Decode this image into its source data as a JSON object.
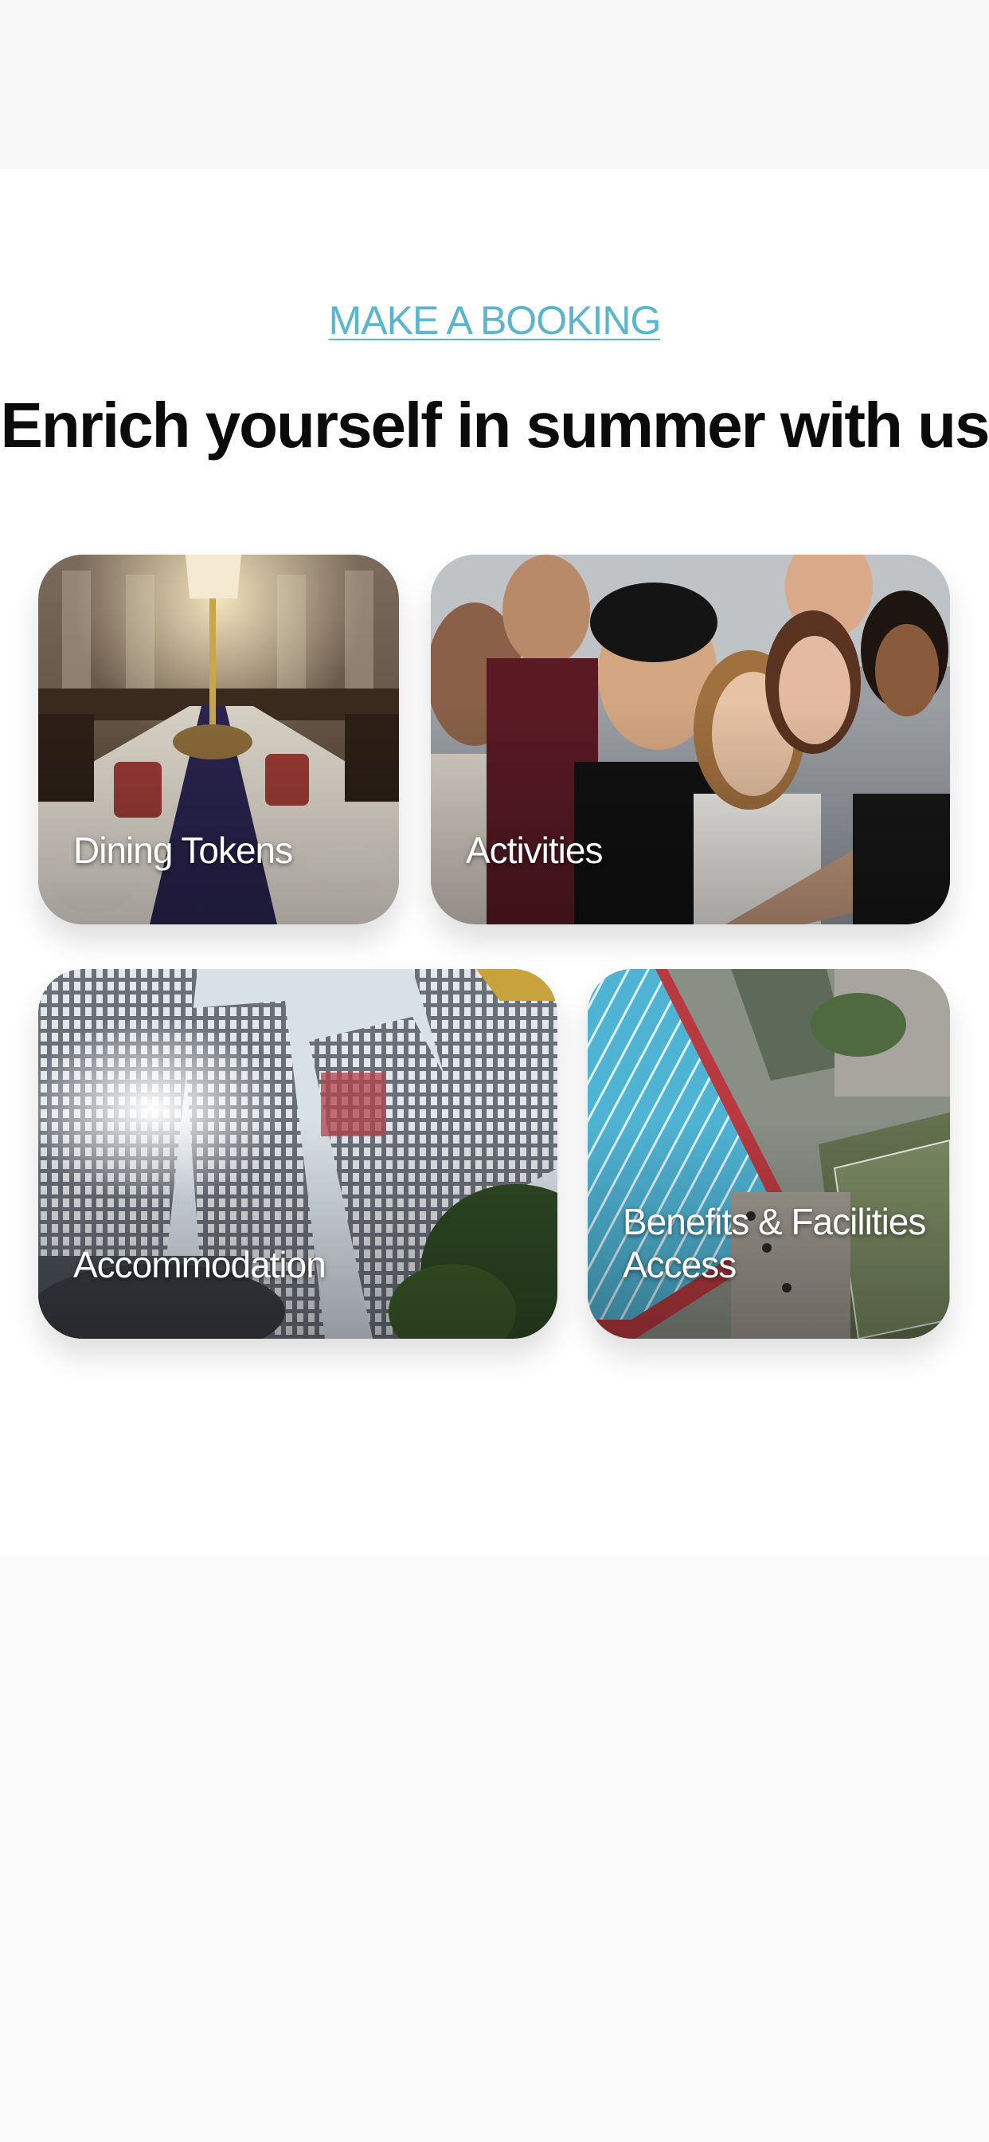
{
  "booking_link": {
    "label": "MAKE A BOOKING"
  },
  "headline": "Enrich yourself in summer with us",
  "categories": [
    {
      "label": "Dining Tokens",
      "image": "banquet-hall-dining-table-photo"
    },
    {
      "label": "Activities",
      "image": "group-selfie-friends-photo"
    },
    {
      "label": "Accommodation",
      "image": "high-rise-buildings-photo"
    },
    {
      "label": "Benefits & Facilities Access",
      "image": "aerial-swimming-pool-courts-photo"
    }
  ],
  "colors": {
    "link": "#5ab6cf",
    "headline": "#0b0b0b",
    "background": "#fcfcfd",
    "tile_label": "#ffffff"
  }
}
